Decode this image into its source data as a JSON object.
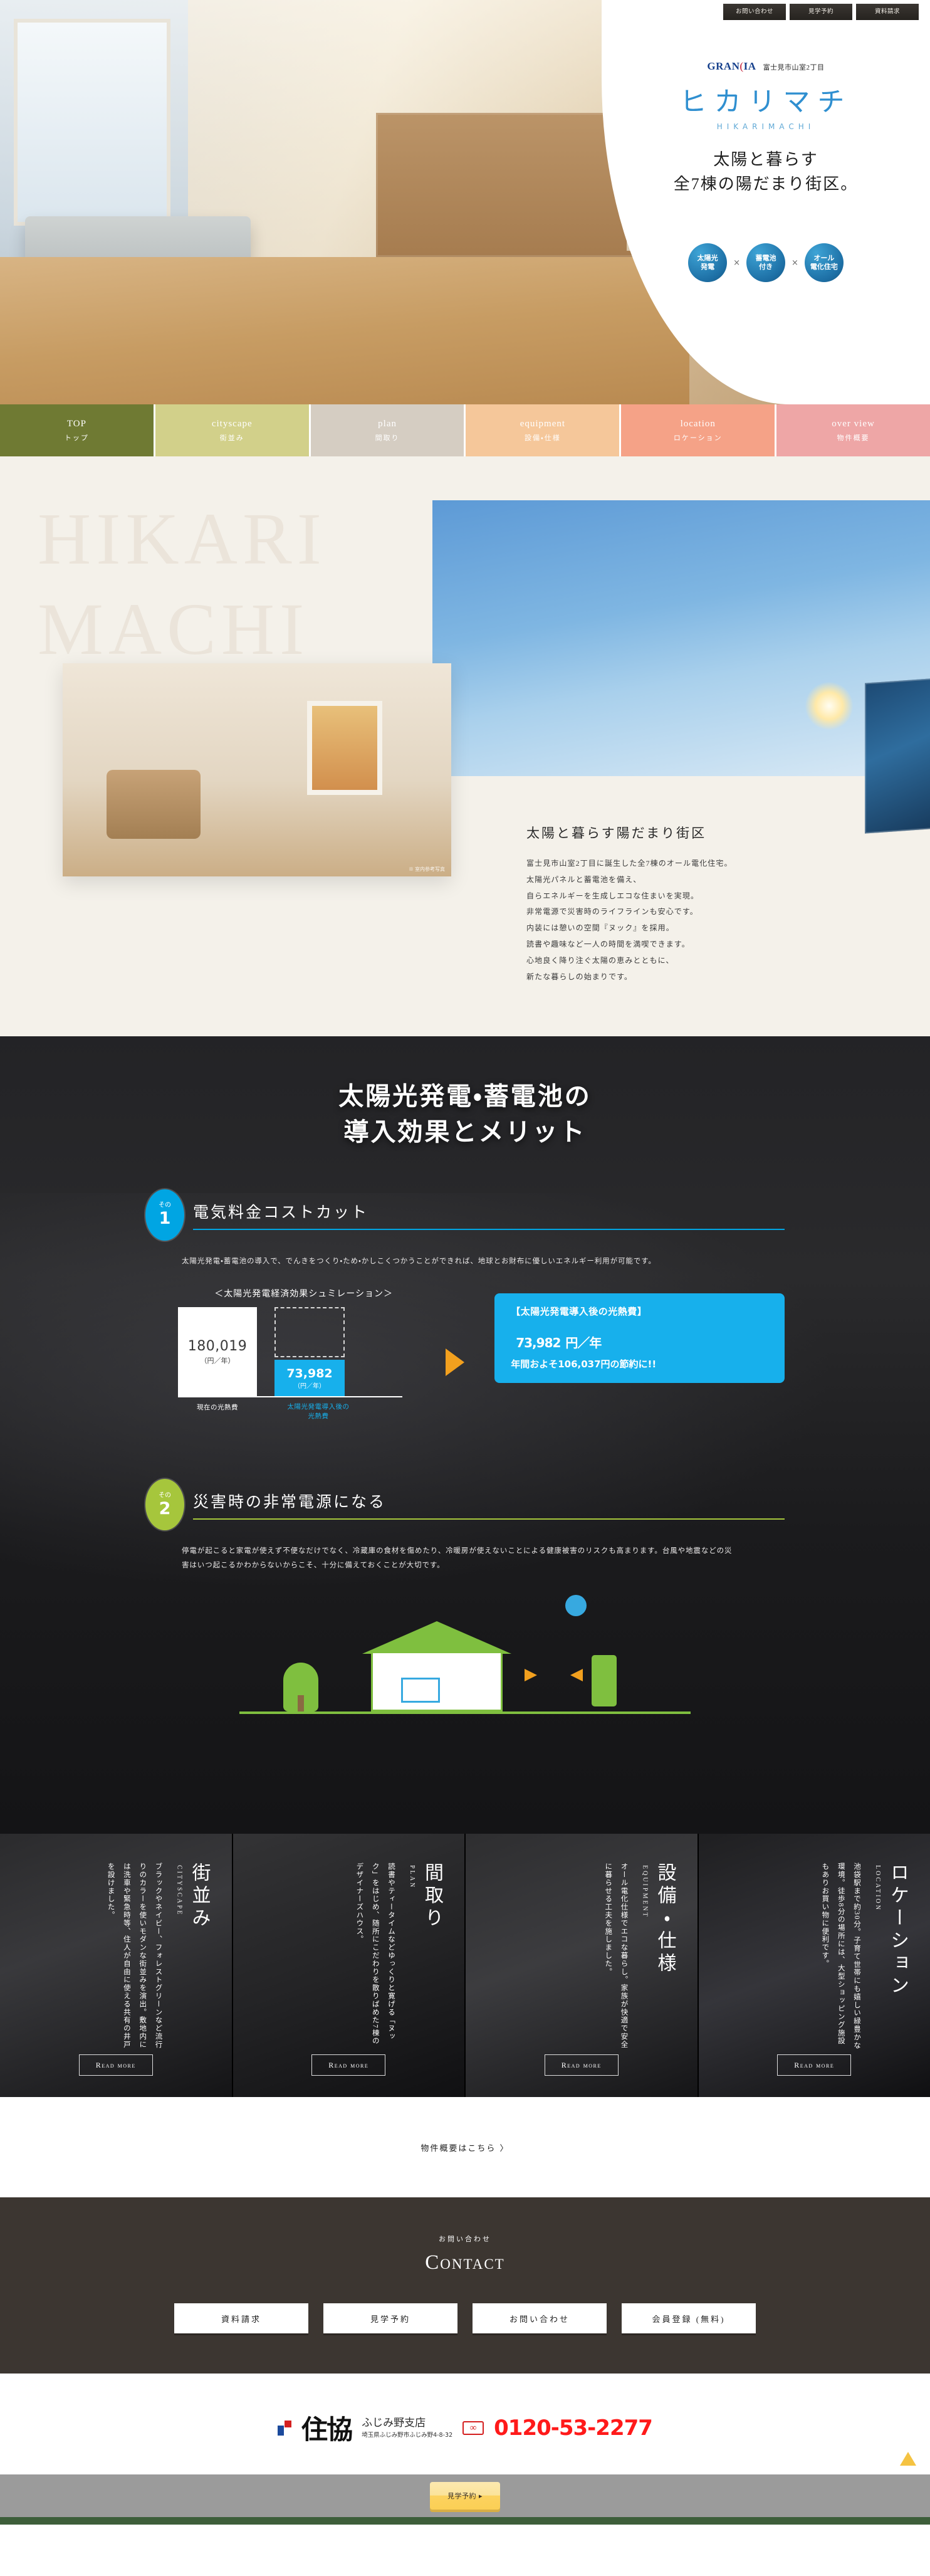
{
  "header": {
    "nav_buttons": [
      {
        "label": "お問い合わせ"
      },
      {
        "label": "見学予約"
      },
      {
        "label": "資料請求"
      }
    ]
  },
  "brand": {
    "grania": "GRAN",
    "grania_tail": "IA",
    "location": "富士見市山室2丁目",
    "logo_jp": "ヒカリマチ",
    "logo_roman": "HIKARIMACHI",
    "tagline_line1": "太陽と暮らす",
    "tagline_line2": "全7棟の陽だまり街区。",
    "badges": [
      {
        "line1": "太陽光",
        "line2": "発電"
      },
      {
        "line1": "蓄電池",
        "line2": "付き"
      },
      {
        "line1": "オール",
        "line2": "電化住宅"
      }
    ],
    "badge_separator": "×"
  },
  "menu": [
    {
      "en": "TOP",
      "jp": "トップ",
      "color": "#6f7a33"
    },
    {
      "en": "cityscape",
      "jp": "街並み",
      "color": "#d2d08a"
    },
    {
      "en": "plan",
      "jp": "間取り",
      "color": "#d5cdc2"
    },
    {
      "en": "equipment",
      "jp": "設備・仕様",
      "color": "#f5c79a"
    },
    {
      "en": "location",
      "jp": "ロケーション",
      "color": "#f5a287"
    },
    {
      "en": "over view",
      "jp": "物件概要",
      "color": "#eea6a6"
    }
  ],
  "intro": {
    "watermark_line1": "HIKARI",
    "watermark_line2": "MACHI",
    "photo_caption": "※ 室内参考写真",
    "heading": "太陽と暮らす陽だまり街区",
    "body": "富士見市山室2丁目に誕生した全7棟のオール電化住宅。\n太陽光パネルと蓄電池を備え、\n自らエネルギーを生成しエコな住まいを実現。\n非常電源で災害時のライフラインも安心です。\n内装には憩いの空間『ヌック』を採用。\n読書や趣味など一人の時間を満喫できます。\n心地良く降り注ぐ太陽の恵みとともに、\n新たな暮らしの始まりです。"
  },
  "merit": {
    "heading_line1": "太陽光発電・蓄電池の",
    "heading_line2": "導入効果とメリット",
    "items": [
      {
        "badge_small": "その",
        "badge_number": "1",
        "badge_color": "#00a5e3",
        "rule_color": "#00a5e3",
        "title": "電気料金コストカット",
        "desc": "太陽光発電・蓄電池の導入で、でんきをつくり・ため・かしこくつかうことができれば、地球とお財布に優しいエネルギー利用が可能です。"
      },
      {
        "badge_small": "その",
        "badge_number": "2",
        "badge_color": "#a6c63c",
        "rule_color": "#a6c63c",
        "title": "災害時の非常電源になる",
        "desc": "停電が起こると家電が使えず不便なだけでなく、冷蔵庫の食材を傷めたり、冷暖房が使えないことによる健康被害のリスクも高まります。台風や地震などの災害はいつ起こるかわからないからこそ、十分に備えておくことが大切です。"
      }
    ],
    "simulation": {
      "caption": "＜太陽光発電経済効果シュミレーション＞",
      "before_value": "180,019",
      "before_unit": "（円／年）",
      "before_label": "現在の光熱費",
      "after_value": "73,982",
      "after_unit": "（円／年）",
      "after_label": "太陽光発電導入後の\n光熱費",
      "result_title": "【太陽光発電導入後の光熱費】",
      "result_value": "73,982",
      "result_unit": "円／年",
      "result_sub": "年間およそ106,037円の節約に!!"
    }
  },
  "cards": [
    {
      "en": "CITYSCAPE",
      "jp": "街並み",
      "text": "ブラックやネイビー、フォレストグリーンなど流行りのカラーを使いモダンな街並みを演出。敷地内には洗車や緊急時等、住人が自由に使える共有の井戸を設けました。",
      "button": "Read more"
    },
    {
      "en": "PLAN",
      "jp": "間取り",
      "text": "読書やティータイムなどゆっくりと寛げる「ヌック」をはじめ、随所にこだわりを散りばめた7棟のデザイナーズハウス。",
      "button": "Read more"
    },
    {
      "en": "EQUIPMENT",
      "jp": "設備・仕様",
      "text": "オール電化仕様でエコな暮らし。家族が快適で安全に暮らせる工夫を施しました。",
      "button": "Read more"
    },
    {
      "en": "LOCATION",
      "jp": "ロケーション",
      "text": "池袋駅まで約30分。子育て世帯にも嬉しい緑豊かな環境。徒歩8分の場所には、大型ショッピング施設もありお買い物に便利です。",
      "button": "Read more"
    }
  ],
  "overview_link": "物件概要はこちら 〉",
  "contact": {
    "small": "お問い合わせ",
    "big": "Contact",
    "buttons": [
      {
        "label": "資料請求"
      },
      {
        "label": "見学予約"
      },
      {
        "label": "お問い合わせ"
      },
      {
        "label": "会員登録 (無料)"
      }
    ]
  },
  "footer": {
    "company": "住協",
    "branch": "ふじみ野支店",
    "address": "埼玉県ふじみ野市ふじみ野4-8-32",
    "tel": "0120-53-2277",
    "freedial_label": "通話料無料"
  },
  "sticky": {
    "reserve_label": "見学予約 ▸"
  }
}
